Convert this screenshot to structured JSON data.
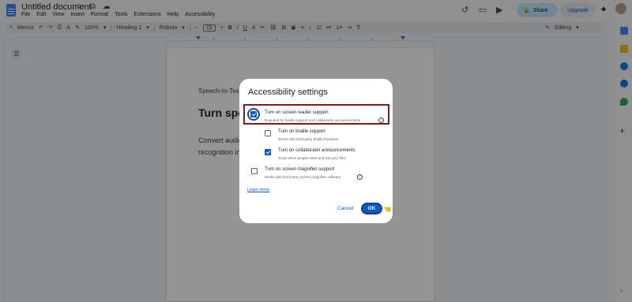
{
  "header": {
    "doc_title": "Untitled document",
    "title_icons": "☆ ⧉ ☁",
    "menu": [
      "File",
      "Edit",
      "View",
      "Insert",
      "Format",
      "Tools",
      "Extensions",
      "Help",
      "Accessibility"
    ],
    "history_icon": "↺",
    "comment_icon": "▭",
    "meet_icon": "▶",
    "share_label": "Share",
    "upgrade_label": "Upgrade"
  },
  "toolbar": {
    "menus_label": "Menus",
    "zoom": "100%",
    "style": "Heading 1",
    "font": "Roboto",
    "font_size": "15",
    "editing_label": "Editing"
  },
  "document": {
    "line1": "Speech-to-Tex",
    "heading": "Turn spe",
    "para1": "Convert audio",
    "para2": "recognition int"
  },
  "dialog": {
    "title": "Accessibility settings",
    "options": [
      {
        "label": "Turn on screen reader support",
        "sub": "Required for braille support and collaborator announcements",
        "checked": true
      },
      {
        "label": "Turn on braille support",
        "sub": "Works with third-party braille hardware",
        "checked": false
      },
      {
        "label": "Turn on collaborator announcements",
        "sub": "Know when people enter and exit your files",
        "checked": true
      },
      {
        "label": "Turn on screen magnifier support",
        "sub": "Works with third-party screen magnifier software",
        "checked": false
      }
    ],
    "learn_more": "Learn more",
    "cancel_label": "Cancel",
    "ok_label": "OK"
  },
  "colors": {
    "accent": "#0b57d0",
    "highlight_box": "#7b1c1c",
    "share_bg": "#c2e7ff"
  }
}
